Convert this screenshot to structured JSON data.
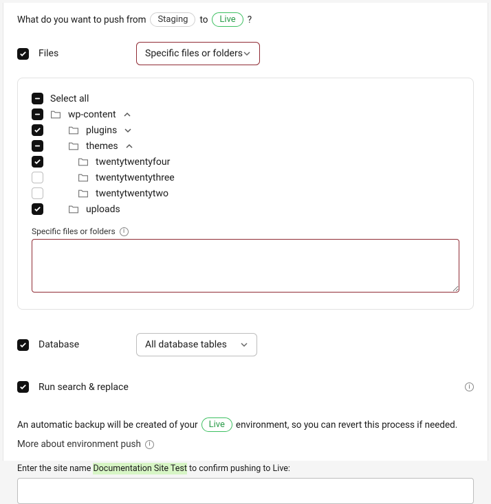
{
  "prompt": {
    "prefix": "What do you want to push from",
    "from": "Staging",
    "mid": "to",
    "to": "Live",
    "suffix": "?"
  },
  "files": {
    "label": "Files",
    "selectLabel": "Specific files or folders",
    "tree": {
      "selectAll": "Select all",
      "wpContent": "wp-content",
      "plugins": "plugins",
      "themes": "themes",
      "t24": "twentytwentyfour",
      "t23": "twentytwentythree",
      "t22": "twentytwentytwo",
      "uploads": "uploads"
    },
    "specificLabel": "Specific files or folders",
    "specificValue": ""
  },
  "database": {
    "label": "Database",
    "selectLabel": "All database tables"
  },
  "searchReplace": {
    "label": "Run search & replace"
  },
  "backup": {
    "prefix": "An automatic backup will be created of your",
    "env": "Live",
    "suffix": "environment, so you can revert this process if needed."
  },
  "moreLink": "More about environment push",
  "confirm": {
    "prefix": "Enter the site name ",
    "siteName": "Documentation Site Test",
    "suffix": " to confirm pushing to Live:",
    "value": ""
  }
}
